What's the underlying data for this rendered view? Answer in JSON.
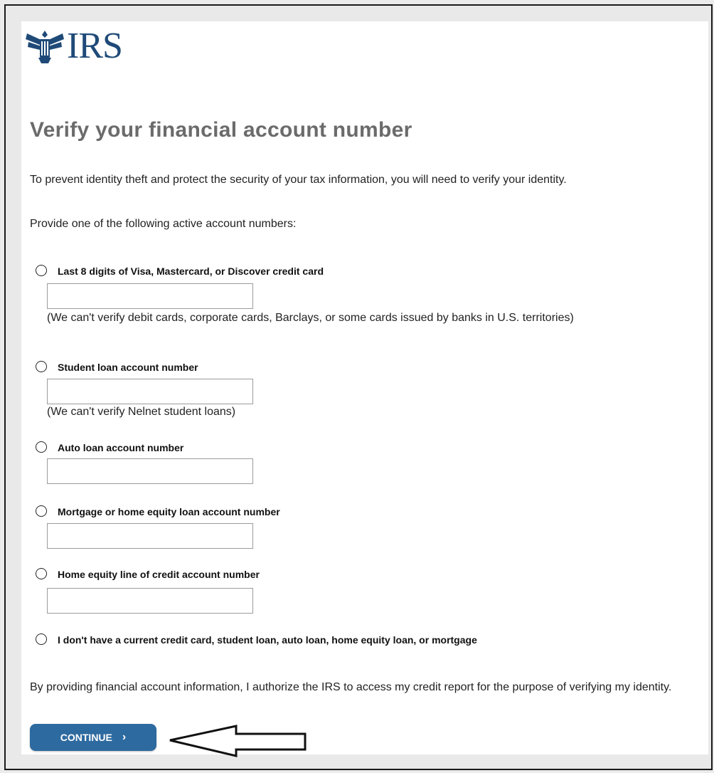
{
  "logo": {
    "text": "IRS",
    "icon": "eagle-emblem-icon"
  },
  "title": "Verify your financial account number",
  "intro": "To prevent identity theft and protect the security of your tax information, you will need to verify your identity.",
  "provide_text": "Provide one of the following active account numbers:",
  "options": [
    {
      "label": "Last 8 digits of Visa, Mastercard, or Discover credit card",
      "value": "",
      "note": "(We can't verify debit cards, corporate cards, Barclays, or some cards issued by banks in U.S. territories)"
    },
    {
      "label": "Student loan account number",
      "value": "",
      "note": "(We can't verify Nelnet student loans)"
    },
    {
      "label": "Auto loan account number",
      "value": ""
    },
    {
      "label": "Mortgage or home equity loan account number",
      "value": ""
    },
    {
      "label": "Home equity line of credit account number",
      "value": ""
    },
    {
      "label": "I don't have a current credit card, student loan, auto loan, home equity loan, or mortgage"
    }
  ],
  "authorization": "By providing financial account information, I authorize the IRS to access my credit report for the purpose of verifying my identity.",
  "continue_button": {
    "label": "CONTINUE",
    "icon": "chevron-right-icon"
  },
  "annotation": {
    "icon": "left-arrow-icon"
  },
  "colors": {
    "brand": "#1f4a78",
    "button": "#2d6a9f",
    "title": "#6b6b6b"
  }
}
